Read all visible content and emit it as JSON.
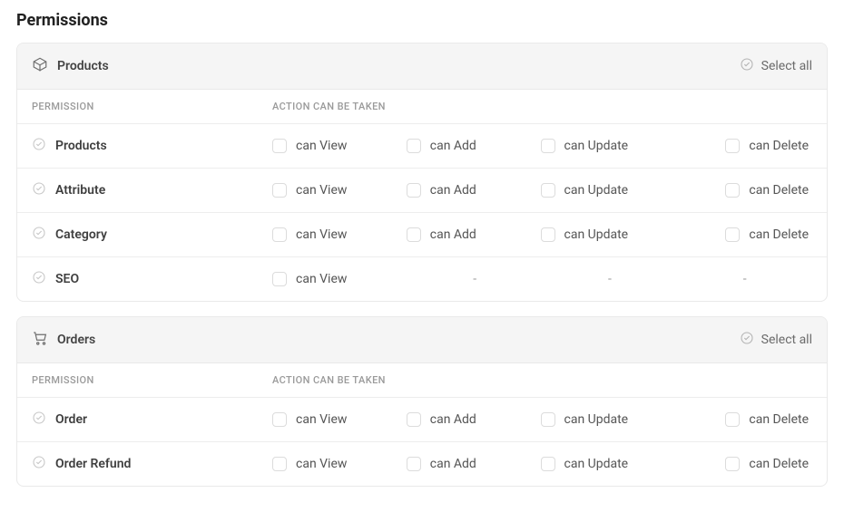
{
  "page": {
    "title": "Permissions"
  },
  "columns": {
    "permission": "PERMISSION",
    "action_header": "ACTION CAN BE TAKEN"
  },
  "labels": {
    "select_all": "Select all",
    "can_view": "can View",
    "can_add": "can Add",
    "can_update": "can Update",
    "can_delete": "can Delete",
    "dash": "-"
  },
  "groups": [
    {
      "title": "Products",
      "icon": "box-icon",
      "rows": [
        {
          "name": "Products",
          "view": true,
          "add": true,
          "update": true,
          "delete": true
        },
        {
          "name": "Attribute",
          "view": true,
          "add": true,
          "update": true,
          "delete": true
        },
        {
          "name": "Category",
          "view": true,
          "add": true,
          "update": true,
          "delete": true
        },
        {
          "name": "SEO",
          "view": true,
          "add": false,
          "update": false,
          "delete": false
        }
      ]
    },
    {
      "title": "Orders",
      "icon": "cart-icon",
      "rows": [
        {
          "name": "Order",
          "view": true,
          "add": true,
          "update": true,
          "delete": true
        },
        {
          "name": "Order Refund",
          "view": true,
          "add": true,
          "update": true,
          "delete": true
        }
      ]
    }
  ]
}
